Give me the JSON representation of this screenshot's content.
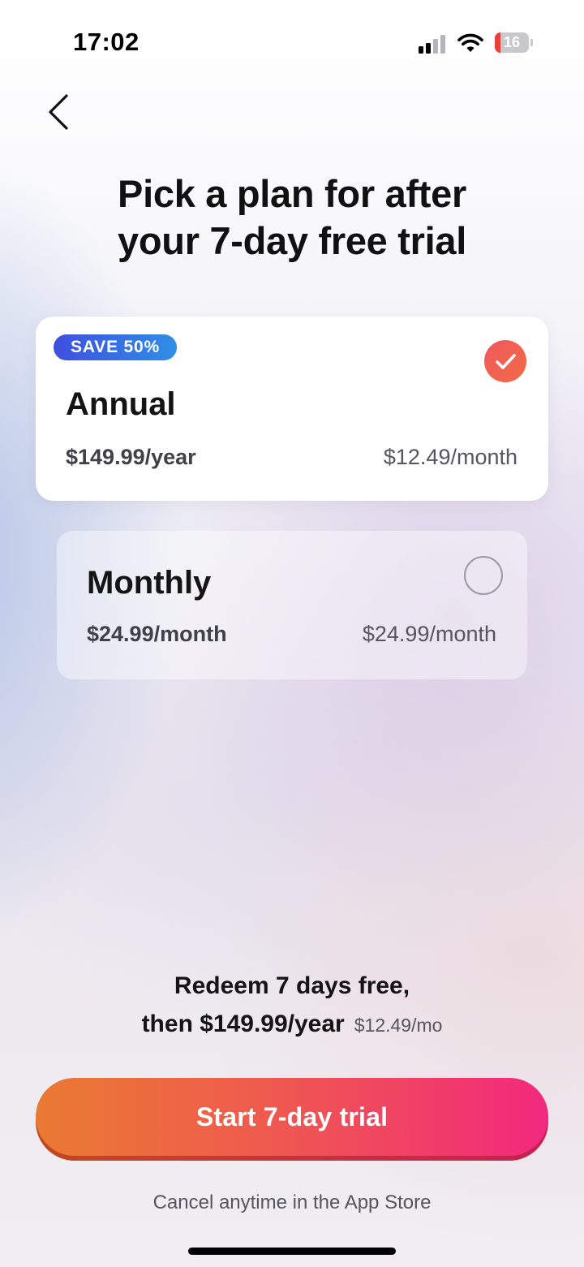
{
  "status_bar": {
    "time": "17:02",
    "battery_level": "16",
    "battery_fraction": 0.16,
    "signal_bars_active": 2,
    "signal_bars_total": 4,
    "icons": [
      "cellular-signal-icon",
      "wifi-icon",
      "battery-icon"
    ],
    "battery_color": "#e9403a"
  },
  "nav": {
    "back_icon": "chevron-left-icon"
  },
  "header": {
    "title_line1": "Pick a plan for after",
    "title_line2": "your 7-day free trial"
  },
  "plans": [
    {
      "id": "annual",
      "badge": "SAVE 50%",
      "name": "Annual",
      "price": "$149.99/year",
      "per_month": "$12.49/month",
      "selected": true
    },
    {
      "id": "monthly",
      "name": "Monthly",
      "price": "$24.99/month",
      "per_month": "$24.99/month",
      "selected": false
    }
  ],
  "summary": {
    "line1": "Redeem 7 days free,",
    "line2_price": "then $149.99/year",
    "line2_per": "$12.49/mo"
  },
  "cta": {
    "label": "Start 7-day trial"
  },
  "footer": {
    "note": "Cancel anytime in the App Store"
  },
  "colors": {
    "accent_start": "#ea7a32",
    "accent_end": "#f2287d",
    "badge_start": "#3f4fe0",
    "badge_end": "#2f8fe6",
    "check": "#f0595e"
  }
}
